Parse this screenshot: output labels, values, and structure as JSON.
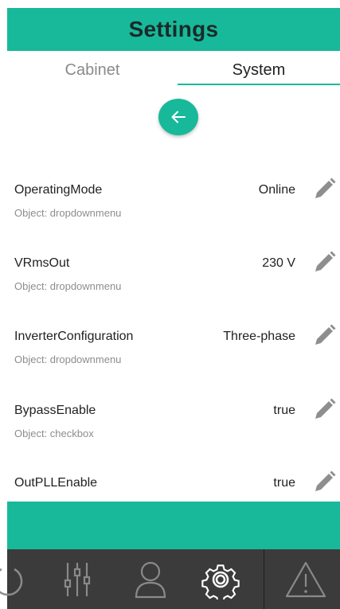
{
  "header": {
    "title": "Settings"
  },
  "tabs": [
    {
      "label": "Cabinet",
      "active": false
    },
    {
      "label": "System",
      "active": true
    }
  ],
  "back_button": {
    "icon": "arrow-left-icon"
  },
  "settings": [
    {
      "name": "OperatingMode",
      "object": "Object: dropdownmenu",
      "value": "Online"
    },
    {
      "name": "VRmsOut",
      "object": "Object: dropdownmenu",
      "value": "230 V"
    },
    {
      "name": "InverterConfiguration",
      "object": "Object: dropdownmenu",
      "value": "Three-phase"
    },
    {
      "name": "BypassEnable",
      "object": "Object: checkbox",
      "value": "true"
    },
    {
      "name": "OutPLLEnable",
      "object": "",
      "value": "true"
    }
  ],
  "bottom_nav": [
    {
      "icon": "power-icon"
    },
    {
      "icon": "sliders-icon"
    },
    {
      "icon": "user-icon"
    },
    {
      "icon": "gear-icon",
      "active": true
    },
    {
      "icon": "warning-icon"
    }
  ],
  "colors": {
    "accent": "#18b99a",
    "nav_background": "#3b3b3b",
    "nav_icon": "#8a8a8a"
  }
}
